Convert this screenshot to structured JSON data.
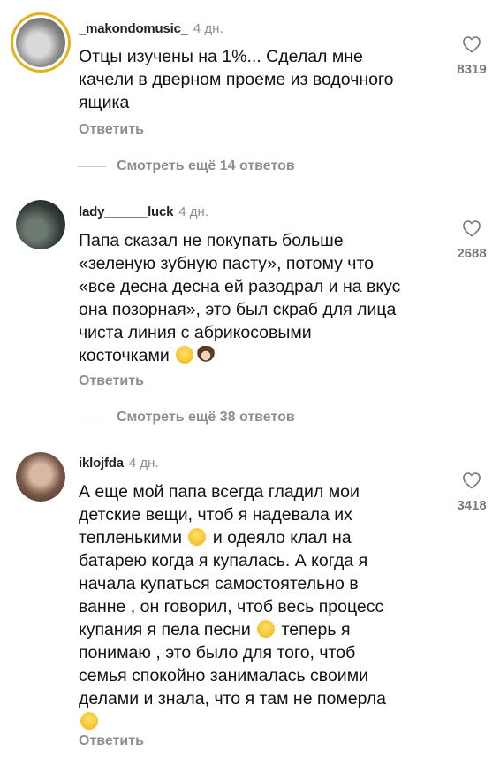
{
  "comments": [
    {
      "username": "_makondomusic_",
      "time": "4 дн.",
      "lines": [
        "Отцы изучены на 1%... Сделал мне",
        "качели в дверном проеме из водочного",
        "ящика"
      ],
      "likes": "8319",
      "reply_label": "Ответить",
      "view_replies": "Смотреть ещё 14 ответов"
    },
    {
      "username": "lady______luck",
      "time": "4 дн.",
      "lines": [
        "Папа сказал не покупать больше",
        "«зеленую зубную пасту», потому что",
        "«все десна десна ей разодрал и на вкус",
        "она позорная», это был скраб для лица",
        "чиста линия с абрикосовыми",
        "косточками"
      ],
      "likes": "2688",
      "reply_label": "Ответить",
      "view_replies": "Смотреть ещё 38 ответов"
    },
    {
      "username": "iklojfda",
      "time": "4 дн.",
      "lines": [
        "А еще мой папа всегда гладил мои",
        "детские вещи, чтоб я надевала их",
        "тепленькими",
        "и одеяло клал на",
        "батарею когда я купалась. А когда я",
        "начала купаться самостоятельно в",
        "ванне , он говорил, чтоб весь процесс",
        "купания я пела песни",
        "теперь я",
        "понимаю , это было для того, чтоб",
        "семья спокойно занималась своими",
        "делами и знала, что я там не померла"
      ],
      "likes": "3418",
      "reply_label": "Ответить"
    }
  ],
  "icons": {
    "like": "heart-outline-icon",
    "emoji_laugh": "grinning-squinting-face",
    "emoji_woman": "woman-face",
    "emoji_smile": "smiling-face"
  },
  "colors": {
    "story_ring": "#e1b21b",
    "secondary_text": "#8e8e8e"
  }
}
